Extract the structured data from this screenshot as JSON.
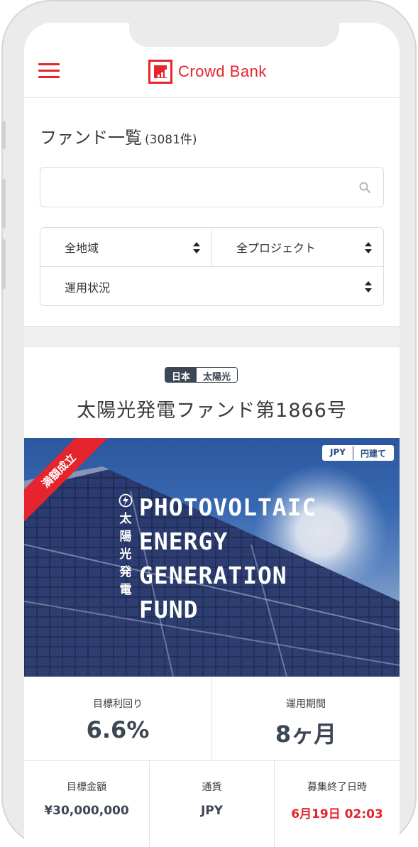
{
  "colors": {
    "accent": "#e5242d",
    "dark": "#3d4654",
    "frame": "#ebebeb"
  },
  "header": {
    "logo_text": "Crowd Bank",
    "menu_icon": "hamburger-icon"
  },
  "page": {
    "title": "ファンド一覧",
    "count": "(3081件)"
  },
  "search": {
    "value": "",
    "placeholder": "",
    "icon": "search-icon"
  },
  "filters": {
    "region": "全地域",
    "project": "全プロジェクト",
    "status": "運用状況"
  },
  "fund": {
    "tags": [
      "日本",
      "太陽光"
    ],
    "title": "太陽光発電ファンド第1866号",
    "ribbon": "満額成立",
    "currency_tags": [
      "JPY",
      "円建て"
    ],
    "image_vertical_text": [
      "太",
      "陽",
      "光",
      "発",
      "電"
    ],
    "image_lines": [
      "PHOTOVOLTAIC",
      "ENERGY",
      "GENERATION",
      "FUND"
    ],
    "stats": {
      "yield_label": "目標利回り",
      "yield_value": "6.6%",
      "term_label": "運用期間",
      "term_value": "8ヶ月",
      "amount_label": "目標金額",
      "amount_value": "¥30,000,000",
      "currency_label": "通貨",
      "currency_value": "JPY",
      "deadline_label": "募集終了日時",
      "deadline_value": "6月19日 02:03"
    }
  }
}
